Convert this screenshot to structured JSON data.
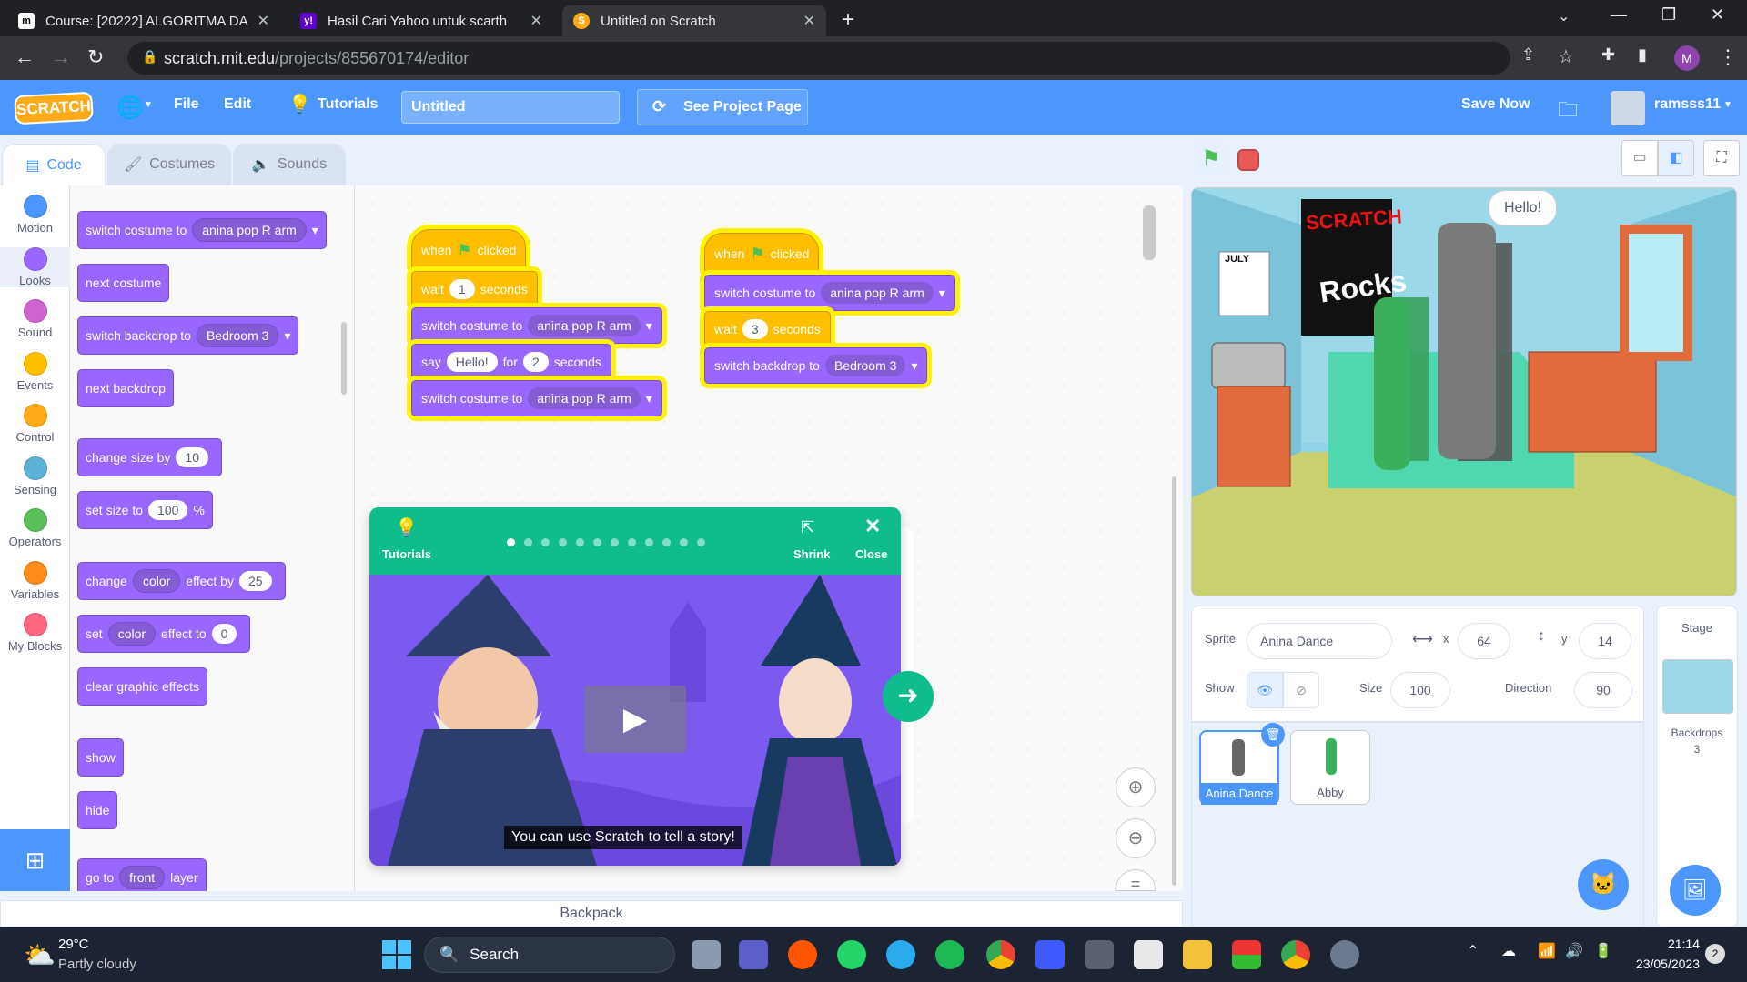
{
  "browser": {
    "tabs": [
      {
        "title": "Course: [20222] ALGORITMA DA",
        "favicon": "m"
      },
      {
        "title": "Hasil Cari Yahoo untuk scarth",
        "favicon": "y!"
      },
      {
        "title": "Untitled on Scratch",
        "favicon": "S"
      }
    ],
    "url_domain": "scratch.mit.edu",
    "url_path": "/projects/855670174/editor",
    "profile_initial": "M"
  },
  "menu": {
    "logo": "SCRATCH",
    "file": "File",
    "edit": "Edit",
    "tutorials": "Tutorials",
    "project_title": "Untitled",
    "see_project": "See Project Page",
    "save_now": "Save Now",
    "username": "ramsss11"
  },
  "editor_tabs": {
    "code": "Code",
    "costumes": "Costumes",
    "sounds": "Sounds"
  },
  "categories": [
    {
      "label": "Motion",
      "color": "#4c97ff"
    },
    {
      "label": "Looks",
      "color": "#9966ff"
    },
    {
      "label": "Sound",
      "color": "#cf63cf"
    },
    {
      "label": "Events",
      "color": "#ffbf00"
    },
    {
      "label": "Control",
      "color": "#ffab19"
    },
    {
      "label": "Sensing",
      "color": "#5cb1d6"
    },
    {
      "label": "Operators",
      "color": "#59c059"
    },
    {
      "label": "Variables",
      "color": "#ff8c1a"
    },
    {
      "label": "My Blocks",
      "color": "#ff6680"
    }
  ],
  "palette": {
    "switch_costume": "switch costume to",
    "costume_value": "anina pop R arm",
    "next_costume": "next costume",
    "switch_backdrop": "switch backdrop to",
    "backdrop_value": "Bedroom 3",
    "next_backdrop": "next backdrop",
    "change_size": "change size by",
    "change_size_value": "10",
    "set_size": "set size to",
    "set_size_value": "100",
    "percent": "%",
    "change": "change",
    "effect_value": "color",
    "effect_by": "effect by",
    "effect_change_value": "25",
    "set": "set",
    "effect_to": "effect to",
    "effect_set_value": "0",
    "clear_effects": "clear graphic effects",
    "show": "show",
    "hide": "hide",
    "go_to": "go to",
    "layer_value": "front",
    "layer": "layer"
  },
  "script1": {
    "when": "when",
    "clicked": "clicked",
    "wait": "wait",
    "wait_value": "1",
    "seconds": "seconds",
    "switch_costume": "switch costume to",
    "costume_value": "anina pop R arm",
    "say": "say",
    "say_value": "Hello!",
    "for": "for",
    "say_secs": "2",
    "switch_costume2": "switch costume to",
    "costume_value2": "anina pop R arm"
  },
  "script2": {
    "when": "when",
    "clicked": "clicked",
    "switch_costume": "switch costume to",
    "costume_value": "anina pop R arm",
    "wait": "wait",
    "wait_value": "3",
    "seconds": "seconds",
    "switch_backdrop": "switch backdrop to",
    "backdrop_value": "Bedroom 3"
  },
  "tutorial": {
    "label": "Tutorials",
    "shrink": "Shrink",
    "close": "Close",
    "caption": "You can use Scratch to tell a story!",
    "total_steps": 12,
    "current_step": 1
  },
  "stage": {
    "speech": "Hello!",
    "poster_line1": "SCRATCH",
    "poster_line2": "Rocks",
    "calendar": "JULY"
  },
  "sprite_info": {
    "sprite_label": "Sprite",
    "sprite_name": "Anina Dance",
    "x_label": "x",
    "x": "64",
    "y_label": "y",
    "y": "14",
    "show_label": "Show",
    "size_label": "Size",
    "size": "100",
    "direction_label": "Direction",
    "direction": "90"
  },
  "sprites": [
    {
      "name": "Anina Dance",
      "selected": true
    },
    {
      "name": "Abby",
      "selected": false
    }
  ],
  "stage_pane": {
    "title": "Stage",
    "backdrops_label": "Backdrops",
    "backdrops_count": "3"
  },
  "backpack": "Backpack",
  "taskbar": {
    "temp": "29°C",
    "weather": "Partly cloudy",
    "search": "Search",
    "time": "21:14",
    "date": "23/05/2023",
    "notif_count": "2"
  }
}
